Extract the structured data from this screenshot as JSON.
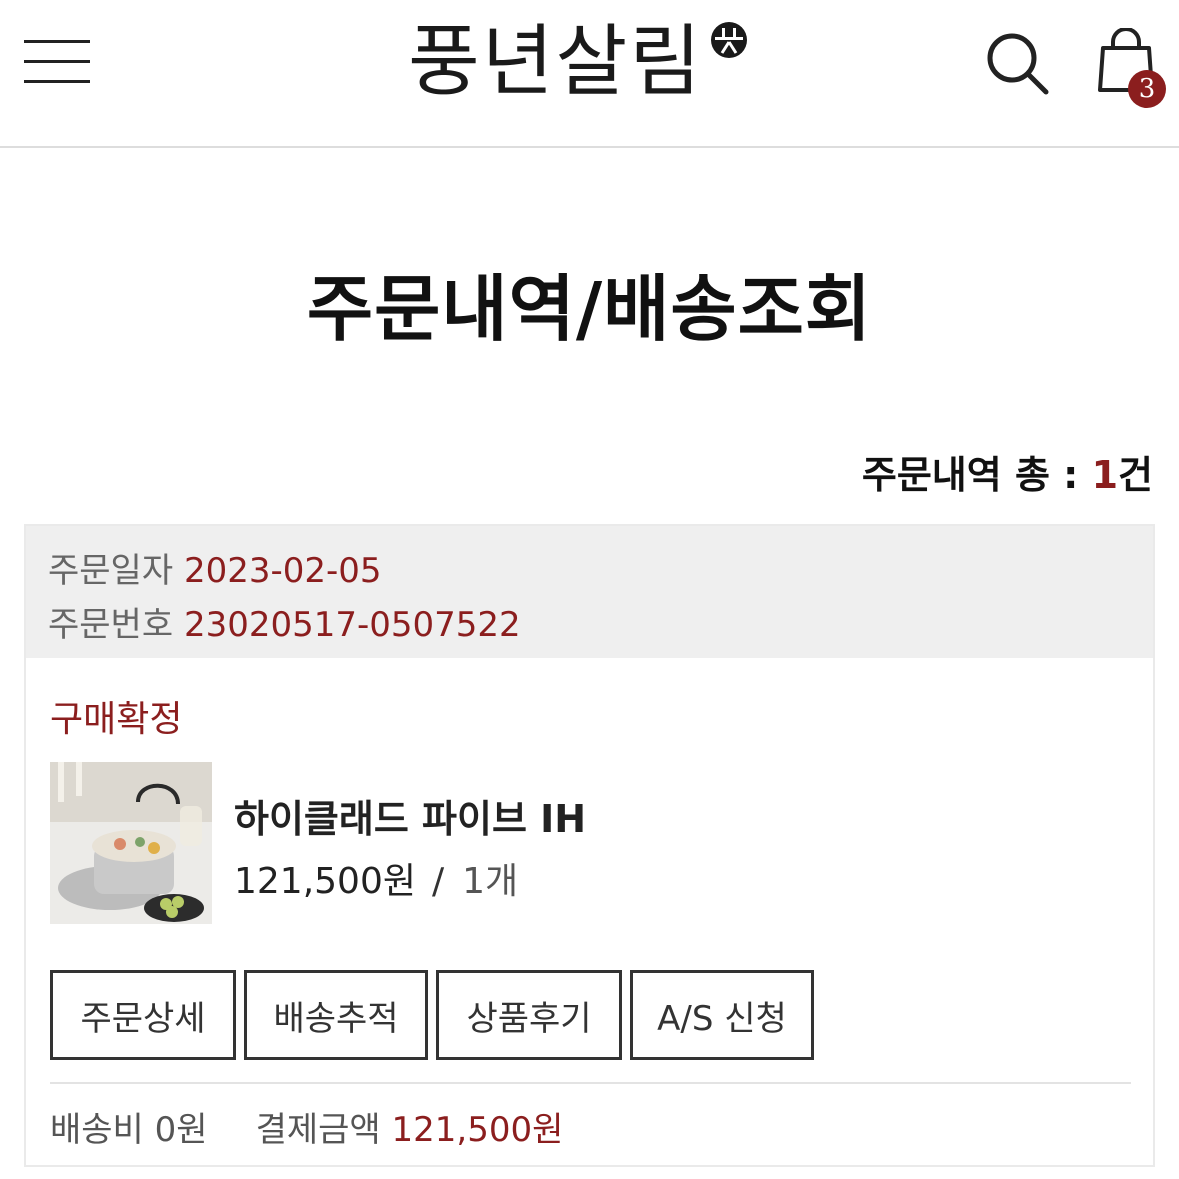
{
  "header": {
    "logo_text": "풍년살림",
    "cart_count": "3"
  },
  "page": {
    "title": "주문내역/배송조회",
    "count_label": "주문내역 총 : ",
    "count_value": "1",
    "count_unit": "건"
  },
  "order": {
    "date_label": "주문일자",
    "date_value": "2023-02-05",
    "number_label": "주문번호",
    "number_value": "23020517-0507522",
    "status": "구매확정",
    "product": {
      "name": "하이클래드 파이브 IH",
      "price": "121,500원",
      "separator": "/",
      "quantity": "1개"
    },
    "buttons": [
      {
        "label": "주문상세"
      },
      {
        "label": "배송추적"
      },
      {
        "label": "상품후기"
      },
      {
        "label": "A/S 신청"
      }
    ],
    "shipping_label": "배송비",
    "shipping_value": "0원",
    "payment_label": "결제금액",
    "payment_value": "121,500원"
  },
  "colors": {
    "accent": "#8b1e1e",
    "header_bg": "#efefef"
  }
}
